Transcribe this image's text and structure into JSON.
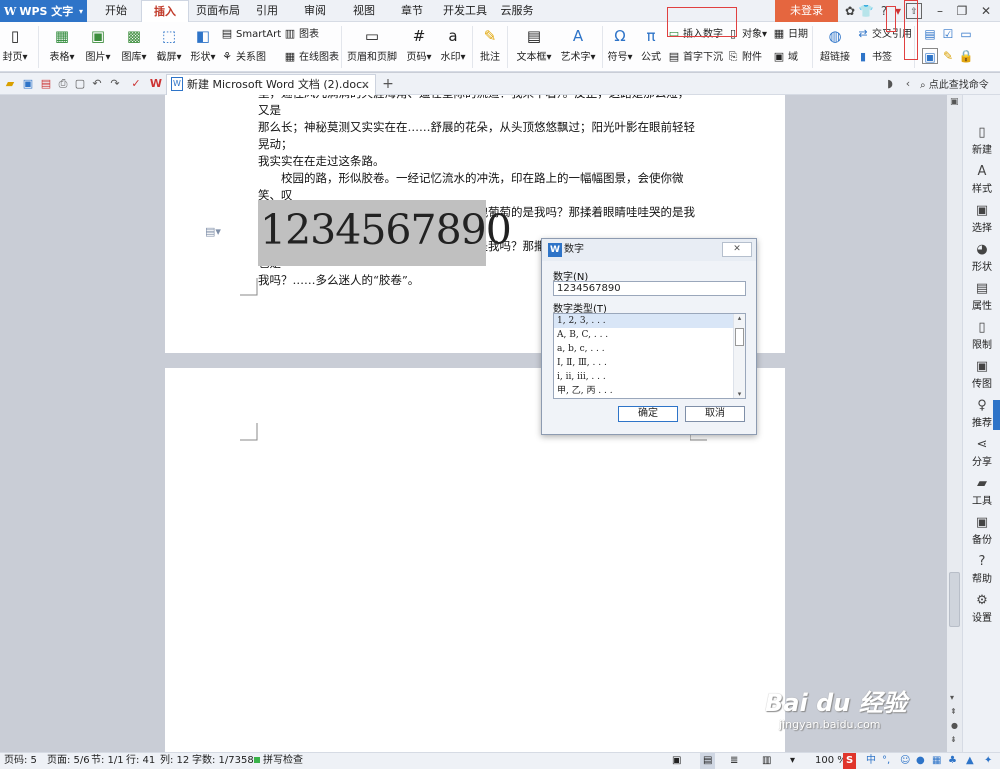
{
  "app": {
    "name": "WPS 文字",
    "logo": "W"
  },
  "menu_tabs": [
    "开始",
    "插入",
    "页面布局",
    "引用",
    "审阅",
    "视图",
    "章节",
    "开发工具",
    "云服务"
  ],
  "active_tab": "插入",
  "login_label": "未登录",
  "ribbon": {
    "page_group": "封页",
    "table": "表格",
    "picture": "图片",
    "gallery": "图库",
    "screenshot": "截屏",
    "shape": "形状",
    "smartart": "SmartArt",
    "chart": "图表",
    "relation_chart": "关系图",
    "online_chart": "在线图表",
    "header_footer": "页眉和页脚",
    "page_number": "页码",
    "watermark": "水印",
    "comment": "批注",
    "textbox": "文本框",
    "wordart": "艺术字",
    "symbol": "符号",
    "formula": "公式",
    "insert_number": "插入数字",
    "object": "对象",
    "date": "日期",
    "drop_cap": "首字下沉",
    "attachment": "附件",
    "field": "域",
    "hyperlink": "超链接",
    "cross_ref": "交叉引用",
    "bookmark": "书签"
  },
  "quickbar": {
    "doc_tab": "新建 Microsoft Word 文档 (2).docx *",
    "search": "点此查找命令"
  },
  "document": {
    "para1_l1": "里，遮住风儿满满的天涯海角、遥在星际的流道！我来不着）。反正，这路是那么短，又是",
    "para1_l2": "那么长；神秘莫测又实实在在……舒展的花朵，从头顶悠悠飘过；阳光叶影在眼前轻轻晃动；",
    "para1_l3": "我实实在在走过这条路。",
    "para2_l1": "　　校园的路，形似胶卷。一经记忆流水的冲洗，印在路上的一幅幅图景，会使你微笑、叹",
    "para2_l2": "息，沉迷不醒……天呐！那从地上跳起，去拽葡萄的是我吗？那揉着眼睛哇哇哭的是我吗？",
    "para2_l3": "那依偎柳树，盯住盘旋在云空的雄鹰的，也是我吗？那撒娇般地拽住老师手儿直摇纺，也是",
    "para2_l4": "我吗？……多么迷人的“胶卷”。",
    "inserted_number": "1234567890"
  },
  "dialog": {
    "title": "数字",
    "number_label": "数字(N)",
    "number_value": "1234567890",
    "type_label": "数字类型(T)",
    "types": [
      "1, 2, 3, . . .",
      "A, B, C, . . .",
      "a, b, c, . . .",
      "Ⅰ, Ⅱ, Ⅲ, . . .",
      "i, ii, iii, . . .",
      "甲, 乙, 丙 . . ."
    ],
    "selected_type_index": 0,
    "ok": "确定",
    "cancel": "取消"
  },
  "right_pane": [
    "新建",
    "样式",
    "选择",
    "形状",
    "属性",
    "限制",
    "传图",
    "推荐",
    "分享",
    "工具",
    "备份",
    "帮助",
    "设置"
  ],
  "status": {
    "page": "页码: 5",
    "pages": "页面: 5/6",
    "section": "节: 1/1",
    "row": "行: 41",
    "col": "列: 12",
    "words": "字数: 1/7358",
    "spell": "拼写检查",
    "zoom": "100 %"
  },
  "watermark": {
    "line1": "Bai du 经验",
    "line2": "jingyan.baidu.com"
  },
  "colors": {
    "accent": "#2e74c8",
    "login": "#e5663f",
    "highlight": "#e04040",
    "active_tab_text": "#c13b2a"
  }
}
